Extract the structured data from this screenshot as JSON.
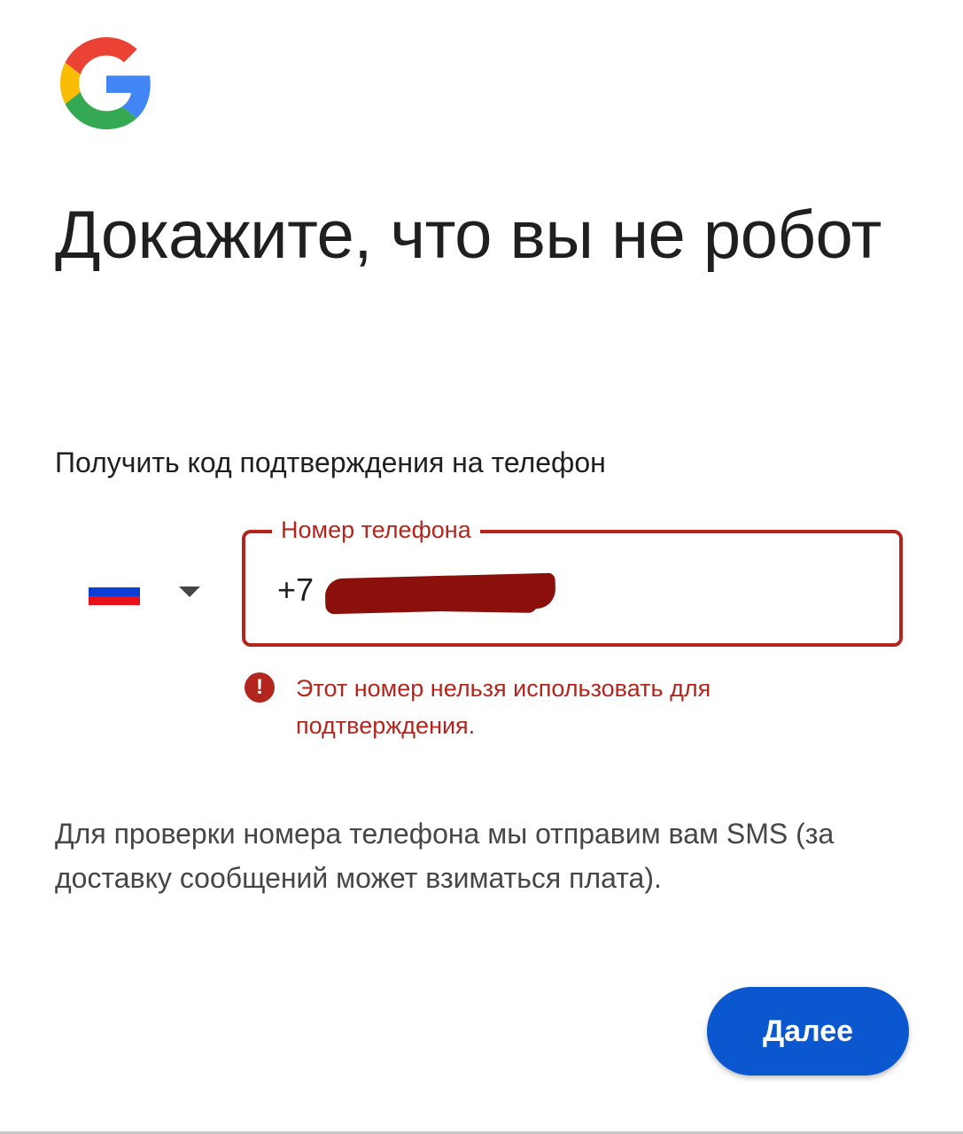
{
  "header": {
    "logo_icon": "google-g-logo",
    "title": "Докажите, что вы не робот"
  },
  "verification": {
    "subtitle": "Получить код подтверждения на телефон",
    "country": {
      "flag_icon": "russia-flag-icon",
      "dropdown_icon": "caret-down-icon"
    },
    "phone_field": {
      "label": "Номер телефона",
      "value": "+7",
      "value_redacted": true
    },
    "error": {
      "icon": "error-icon",
      "message": "Этот номер нельзя использовать для подтверждения."
    },
    "info": "Для проверки номера телефона мы отправим вам SMS (за доставку сообщений может взиматься плата)."
  },
  "actions": {
    "next_label": "Далее"
  },
  "colors": {
    "error": "#b3261e",
    "primary": "#0b57d0",
    "text": "#1f1f1f",
    "secondary_text": "#444746",
    "redaction": "#8b0f0a"
  }
}
